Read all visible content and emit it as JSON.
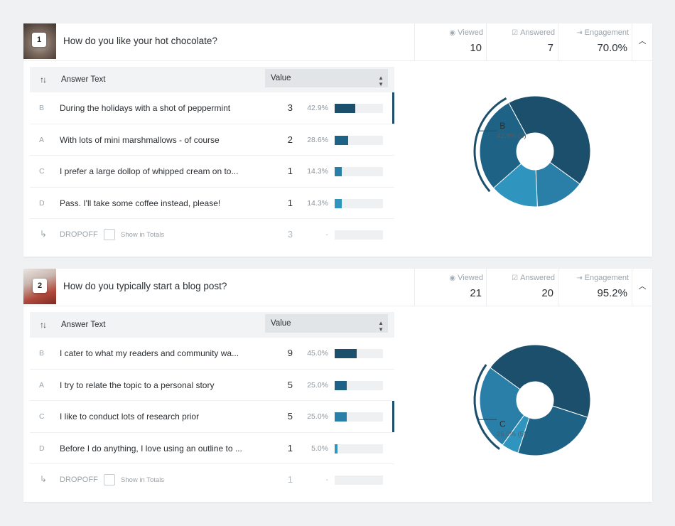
{
  "questions": [
    {
      "number": "1",
      "title": "How do you like your hot chocolate?",
      "stats": {
        "viewed_label": "Viewed",
        "viewed": "10",
        "answered_label": "Answered",
        "answered": "7",
        "engagement_label": "Engagement",
        "engagement": "70.0%"
      },
      "table": {
        "answer_header": "Answer Text",
        "value_header": "Value",
        "rows": [
          {
            "letter": "B",
            "text": "During the holidays with a shot of peppermint",
            "count": "3",
            "pct": "42.9%",
            "fraction": 0.429,
            "color": "#1c4f6b"
          },
          {
            "letter": "A",
            "text": "With lots of mini marshmallows - of course",
            "count": "2",
            "pct": "28.6%",
            "fraction": 0.286,
            "color": "#1e6286"
          },
          {
            "letter": "C",
            "text": "I prefer a large dollop of whipped cream on to...",
            "count": "1",
            "pct": "14.3%",
            "fraction": 0.143,
            "color": "#2a7fa8"
          },
          {
            "letter": "D",
            "text": "Pass.  I'll take some coffee instead, please!",
            "count": "1",
            "pct": "14.3%",
            "fraction": 0.143,
            "color": "#2f95bf"
          }
        ],
        "dropoff": {
          "label": "DROPOFF",
          "checkbox_label": "Show in Totals",
          "count": "3",
          "pct": "-"
        }
      },
      "callout": {
        "letter": "B",
        "detail": "42.9% (3)"
      }
    },
    {
      "number": "2",
      "title": "How do you typically start a blog post?",
      "stats": {
        "viewed_label": "Viewed",
        "viewed": "21",
        "answered_label": "Answered",
        "answered": "20",
        "engagement_label": "Engagement",
        "engagement": "95.2%"
      },
      "table": {
        "answer_header": "Answer Text",
        "value_header": "Value",
        "rows": [
          {
            "letter": "B",
            "text": "I cater to what my readers and community wa...",
            "count": "9",
            "pct": "45.0%",
            "fraction": 0.45,
            "color": "#1c4f6b"
          },
          {
            "letter": "A",
            "text": "I try to relate the topic to a personal story",
            "count": "5",
            "pct": "25.0%",
            "fraction": 0.25,
            "color": "#1e6286"
          },
          {
            "letter": "C",
            "text": "I like to conduct lots of research prior",
            "count": "5",
            "pct": "25.0%",
            "fraction": 0.25,
            "color": "#2a7fa8"
          },
          {
            "letter": "D",
            "text": "Before I do anything, I love using an outline to ...",
            "count": "1",
            "pct": "5.0%",
            "fraction": 0.05,
            "color": "#2f95bf"
          }
        ],
        "dropoff": {
          "label": "DROPOFF",
          "checkbox_label": "Show in Totals",
          "count": "1",
          "pct": "-"
        }
      },
      "callout": {
        "letter": "C",
        "detail": "25.0% (5)"
      }
    }
  ],
  "icons": {
    "viewed": "eye-icon",
    "answered": "checkbox-icon",
    "engagement": "sign-in-icon",
    "collapse": "chevron-up-icon",
    "sort": "sort-icon",
    "caret": "caret-down-icon",
    "dropoff": "dropoff-arrow-icon"
  }
}
